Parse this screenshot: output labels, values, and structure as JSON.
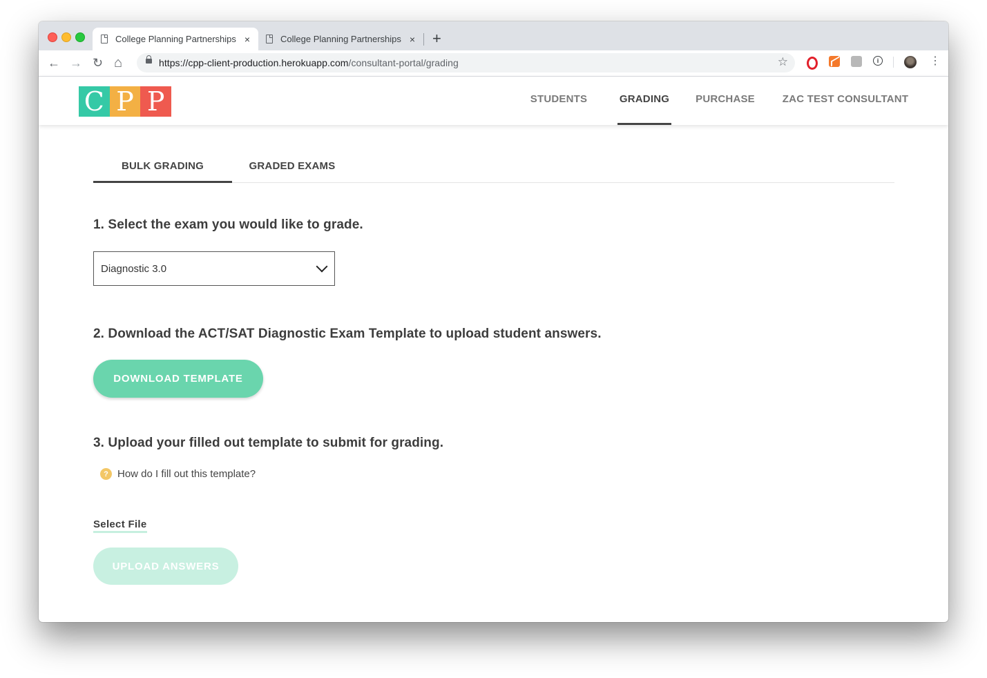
{
  "browser": {
    "tabs": [
      {
        "title": "College Planning Partnerships",
        "close": "×"
      },
      {
        "title": "College Planning Partnerships",
        "close": "×"
      }
    ],
    "new_tab": "+",
    "url_host": "https://cpp-client-production.herokuapp.com",
    "url_path": "/consultant-portal/grading",
    "star": "☆",
    "nav": {
      "back": "←",
      "forward": "→",
      "reload": "↻",
      "home": "⌂"
    },
    "menu": "⋮",
    "ext_info": "i"
  },
  "app": {
    "logo": [
      "C",
      "P",
      "P"
    ],
    "logo_colors": [
      "#35c9a6",
      "#f3b044",
      "#ef5a4f"
    ],
    "accent": "#6ad5ad",
    "nav": {
      "students": "STUDENTS",
      "grading": "GRADING",
      "purchase": "PURCHASE",
      "account": "ZAC TEST CONSULTANT"
    }
  },
  "grading": {
    "tabs": {
      "bulk": "BULK GRADING",
      "graded": "GRADED EXAMS"
    },
    "step1": "1. Select the exam you would like to grade.",
    "exam_select": "Diagnostic 3.0",
    "step2": "2. Download the ACT/SAT Diagnostic Exam Template to upload student answers.",
    "download_button": "DOWNLOAD TEMPLATE",
    "step3": "3. Upload your filled out template to submit for grading.",
    "help_icon": "?",
    "help_link": "How do I fill out this template?",
    "select_file": "Select File",
    "upload_button": "UPLOAD ANSWERS"
  }
}
